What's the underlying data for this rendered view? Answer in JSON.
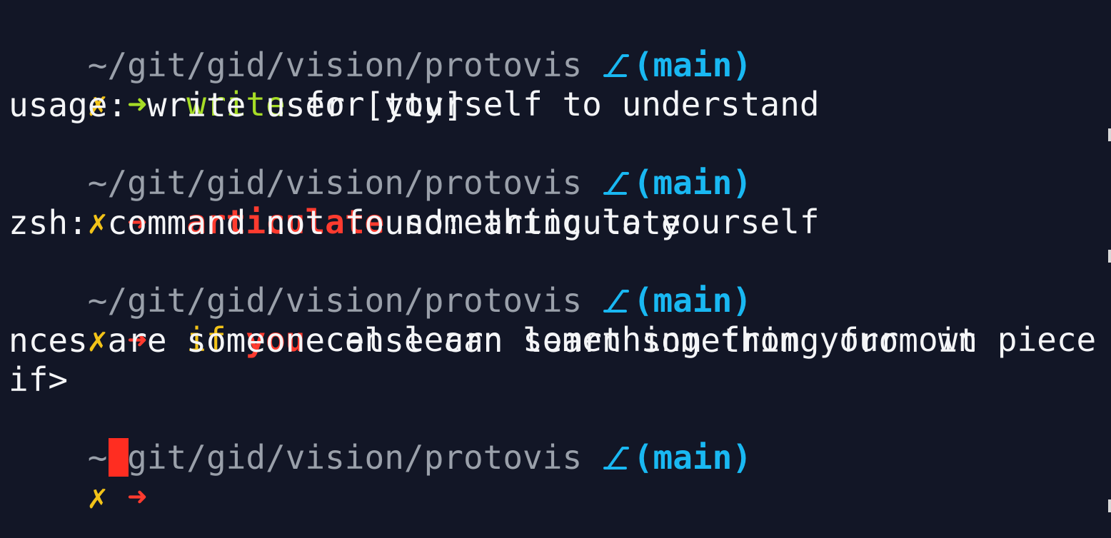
{
  "prompt": {
    "path": "~/git/gid/vision/protovis",
    "branch": "(main)",
    "mark": "✗",
    "arrow": "➜"
  },
  "lines": {
    "cmd1": {
      "command": "write",
      "rest": " for yourself to understand"
    },
    "out1": "usage: write user [tty]",
    "cmd2": {
      "command": "articulate",
      "rest": " something to yourself"
    },
    "out2": "zsh: command not found: articulate",
    "cmd3": {
      "keyword": "if",
      "variable": "you",
      "rest": " can learn something from your own piece cha"
    },
    "wrap3": "nces are someone else can learn something from it",
    "cont3": "if>"
  },
  "colors": {
    "background": "#121626",
    "path": "#9aa0aa",
    "branch": "#19b8f2",
    "success_arrow": "#a6dc26",
    "error": "#ff3b2f",
    "mark": "#f2c318",
    "cursor": "#ff2d21"
  },
  "icons": {
    "git_branch": "git-branch-icon"
  }
}
